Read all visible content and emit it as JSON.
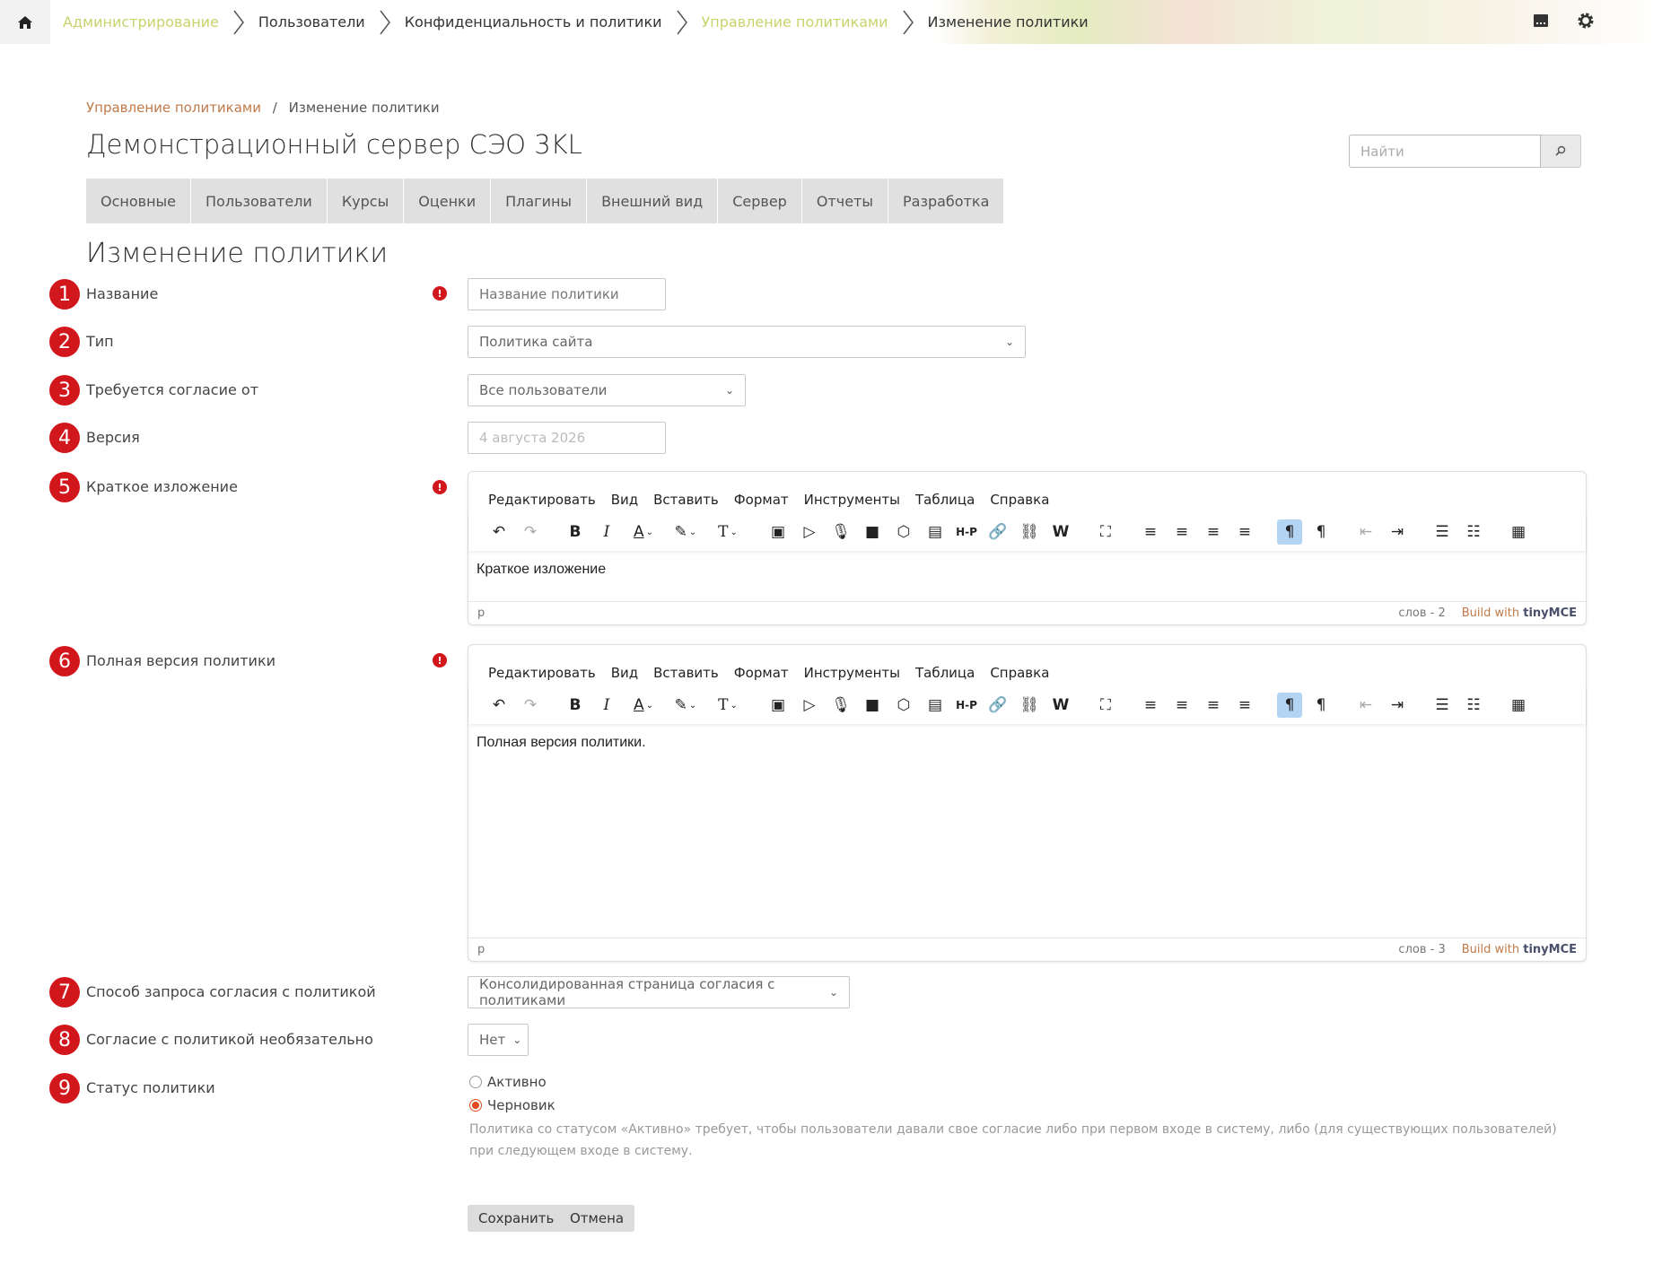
{
  "topbar": {
    "crumbs": [
      "Администрирование",
      "Пользователи",
      "Конфиденциальность и политики",
      "Управление политиками",
      "Изменение политики"
    ]
  },
  "page": {
    "breadcrumb": {
      "link": "Управление политиками",
      "sep": "/",
      "current": "Изменение политики"
    },
    "site_title": "Демонстрационный сервер СЭО 3KL",
    "search_placeholder": "Найти",
    "tabs": [
      "Основные",
      "Пользователи",
      "Курсы",
      "Оценки",
      "Плагины",
      "Внешний вид",
      "Сервер",
      "Отчеты",
      "Разработка"
    ],
    "heading": "Изменение политики"
  },
  "form": {
    "numbers": [
      "1",
      "2",
      "3",
      "4",
      "5",
      "6",
      "7",
      "8",
      "9"
    ],
    "name_label": "Название",
    "name_placeholder": "Название политики",
    "type_label": "Тип",
    "type_value": "Политика сайта",
    "consent_label": "Требуется согласие от",
    "consent_value": "Все пользователи",
    "version_label": "Версия",
    "version_value": "4 августа 2026",
    "summary_label": "Краткое изложение",
    "summary_text": "Краткое изложение",
    "summary_wc": "слов - 2",
    "full_label": "Полная версия политики",
    "full_text": "Полная версия политики.",
    "full_wc": "слов - 3",
    "method_label": "Способ запроса согласия с политикой",
    "method_value": "Консолидированная страница согласия с политиками",
    "optional_label": "Согласие с политикой необязательно",
    "optional_value": "Нет",
    "status_label": "Статус политики",
    "status_active": "Активно",
    "status_draft": "Черновик",
    "status_selected": "Черновик",
    "help": "Политика со статусом «Активно» требует, чтобы пользователи давали свое согласие либо при первом входе в систему, либо (для существующих пользователей) при следующем входе в систему.",
    "save": "Сохранить",
    "cancel": "Отмена"
  },
  "editor": {
    "menu": [
      "Редактировать",
      "Вид",
      "Вставить",
      "Формат",
      "Инструменты",
      "Таблица",
      "Справка"
    ],
    "path": "p",
    "brand_prefix": "Build with",
    "brand_name": "tinyMCE"
  },
  "colors": {
    "accent_red": "#d1161c",
    "link_orange": "#c07a4a",
    "link_lime": "#c9d36b",
    "tab_bg": "#e0e0e0",
    "active_btn": "#b4d4f4"
  }
}
